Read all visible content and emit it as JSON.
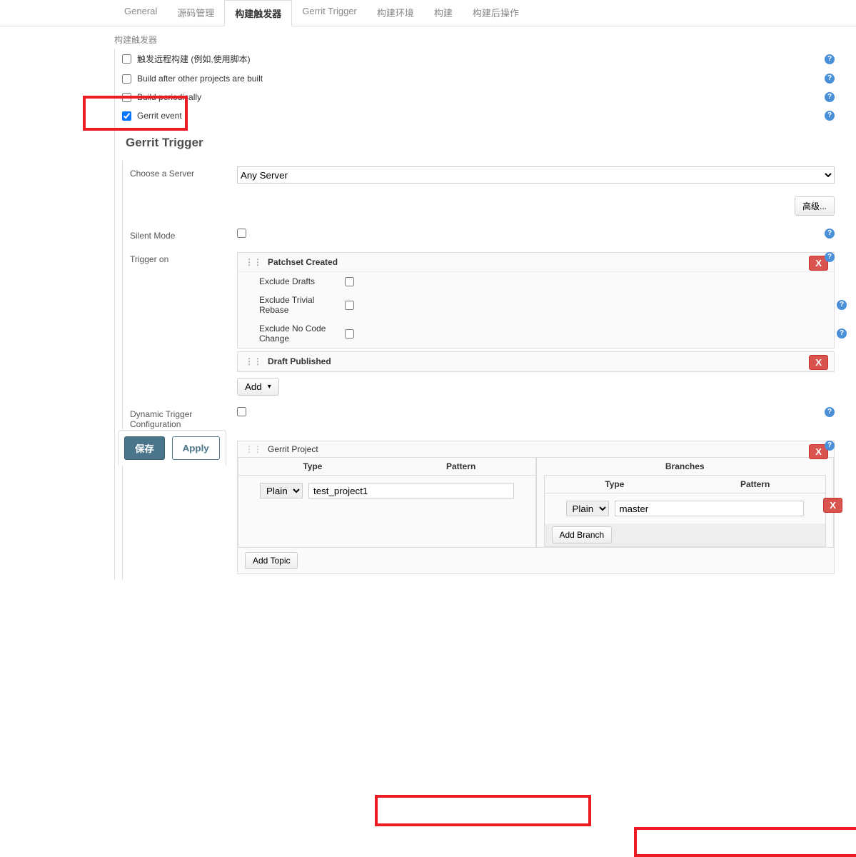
{
  "tabs": {
    "general": "General",
    "scm": "源码管理",
    "triggers": "构建触发器",
    "gerrit": "Gerrit Trigger",
    "env": "构建环境",
    "build": "构建",
    "post": "构建后操作"
  },
  "section_title_truncated": "构建触发器",
  "triggers_list": {
    "remote": "触发远程构建 (例如,使用脚本)",
    "after_projects": "Build after other projects are built",
    "periodically": "Build periodically",
    "gerrit_event": "Gerrit event"
  },
  "gerrit_section": {
    "heading": "Gerrit Trigger",
    "choose_server": "Choose a Server",
    "server_value": "Any Server",
    "advanced": "高级...",
    "silent_mode": "Silent Mode",
    "trigger_on": "Trigger on",
    "patchset_created": "Patchset Created",
    "exclude_drafts": "Exclude Drafts",
    "exclude_trivial": "Exclude Trivial Rebase",
    "exclude_nocode": "Exclude No Code Change",
    "draft_published": "Draft Published",
    "add": "Add",
    "dynamic_config": "Dynamic Trigger Configuration",
    "gerrit_project": "Gerrit Project",
    "type": "Type",
    "pattern": "Pattern",
    "branches": "Branches",
    "plain": "Plain",
    "project_value": "test_project1",
    "branch_value": "master",
    "add_branch": "Add Branch",
    "add_topic": "Add Topic",
    "delete": "X"
  },
  "footer": {
    "save": "保存",
    "apply": "Apply"
  }
}
